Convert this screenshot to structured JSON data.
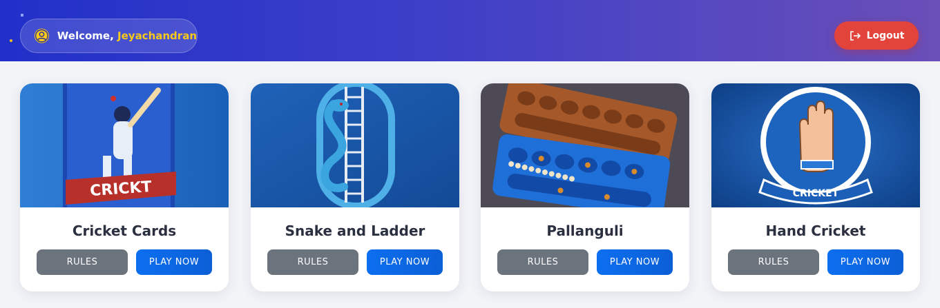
{
  "header": {
    "welcome_prefix": "Welcome, ",
    "user_name": "Jeyachandran",
    "logout_label": "Logout"
  },
  "cards": [
    {
      "title": "Cricket Cards",
      "rules_label": "RULES",
      "play_label": "PLAY NOW",
      "image": "cricket-card-art",
      "image_text": "CRICKT"
    },
    {
      "title": "Snake and Ladder",
      "rules_label": "RULES",
      "play_label": "PLAY NOW",
      "image": "snake-ladder-art"
    },
    {
      "title": "Pallanguli",
      "rules_label": "RULES",
      "play_label": "PLAY NOW",
      "image": "pallanguli-board-art"
    },
    {
      "title": "Hand Cricket",
      "rules_label": "RULES",
      "play_label": "PLAY NOW",
      "image": "hand-cricket-art",
      "image_text": "CRICKET"
    }
  ],
  "colors": {
    "accent_name": "#f7c91a",
    "logout": "#e2443b",
    "play": "#0c6ff0",
    "rules": "#6b737d"
  }
}
